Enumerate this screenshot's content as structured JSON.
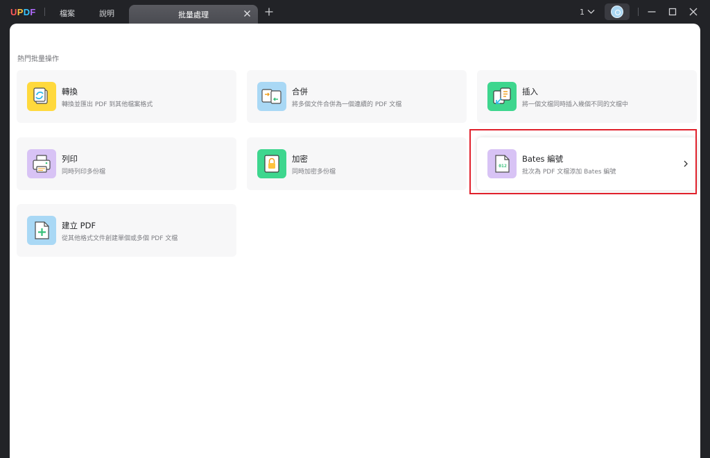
{
  "app": {
    "logo_letters": [
      "U",
      "P",
      "D",
      "F"
    ],
    "logo_colors": [
      "#ff5a5a",
      "#ffc33d",
      "#37c6ff",
      "#b26bff"
    ]
  },
  "menu": {
    "file": "檔案",
    "help": "說明"
  },
  "tab": {
    "label": "批量處理"
  },
  "titlebar": {
    "count": "1"
  },
  "section": {
    "title": "熱門批量操作"
  },
  "cards": [
    {
      "title": "轉換",
      "desc": "轉換並匯出 PDF 到其他檔案格式",
      "icon": "convert-icon",
      "color": "#ffd93d"
    },
    {
      "title": "合併",
      "desc": "將多個文件合併為一個連續的 PDF 文檔",
      "icon": "merge-icon",
      "color": "#a9d8f5"
    },
    {
      "title": "插入",
      "desc": "將一個文檔同時插入幾個不同的文檔中",
      "icon": "insert-icon",
      "color": "#3ed68e"
    },
    {
      "title": "列印",
      "desc": "同時列印多份檔",
      "icon": "printer-icon",
      "color": "#d8c3f5"
    },
    {
      "title": "加密",
      "desc": "同時加密多份檔",
      "icon": "lock-icon",
      "color": "#3ed68e"
    },
    {
      "title": "Bates 編號",
      "desc": "批次為 PDF 文檔添加 Bates 編號",
      "icon": "bates-number-icon",
      "color": "#d8c3f5",
      "icon_text": "012"
    },
    {
      "title": "建立 PDF",
      "desc": "從其他格式文件創建單個或多個 PDF 文檔",
      "icon": "create-pdf-icon",
      "color": "#a9d8f5"
    }
  ],
  "colors": {
    "titlebar_bg": "#222327",
    "tab_bg": "#4f5056",
    "panel_bg": "#ffffff",
    "card_bg": "#f7f7f8",
    "highlight": "#e0202b"
  }
}
